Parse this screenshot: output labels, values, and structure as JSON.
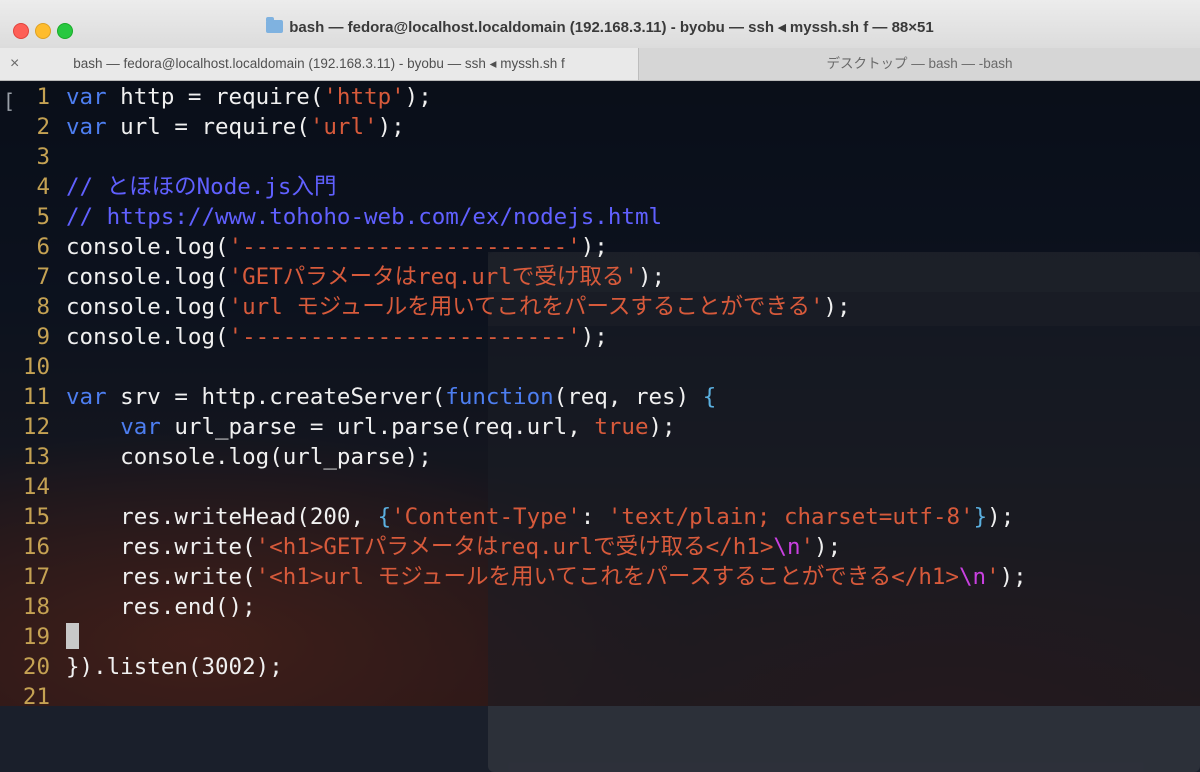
{
  "window": {
    "title": "bash — fedora@localhost.localdomain (192.168.3.11) - byobu — ssh ◂ myssh.sh f — 88×51"
  },
  "tabs": [
    {
      "label": "bash — fedora@localhost.localdomain (192.168.3.11) - byobu — ssh ◂ myssh.sh f",
      "active": true
    },
    {
      "label": "デスクトップ — bash — -bash",
      "active": false
    }
  ],
  "tab_close": "×",
  "bracket": "[",
  "colors": {
    "keyword": "#4d7ef0",
    "string": "#d75a3b",
    "comment": "#6060ff",
    "escape": "#c940e0",
    "line_number": "#c5a253"
  },
  "code": {
    "lines": [
      {
        "n": "1",
        "tokens": [
          [
            "kw",
            "var"
          ],
          [
            "p",
            " http = require("
          ],
          [
            "str",
            "'http'"
          ],
          [
            "p",
            ");"
          ]
        ]
      },
      {
        "n": "2",
        "tokens": [
          [
            "kw",
            "var"
          ],
          [
            "p",
            " url = require("
          ],
          [
            "str",
            "'url'"
          ],
          [
            "p",
            ");"
          ]
        ]
      },
      {
        "n": "3",
        "tokens": []
      },
      {
        "n": "4",
        "tokens": [
          [
            "cmt",
            "// とほほのNode.js入門"
          ]
        ]
      },
      {
        "n": "5",
        "tokens": [
          [
            "cmt",
            "// https://www.tohoho-web.com/ex/nodejs.html"
          ]
        ]
      },
      {
        "n": "6",
        "tokens": [
          [
            "p",
            "console.log("
          ],
          [
            "str",
            "'------------------------'"
          ],
          [
            "p",
            ");"
          ]
        ]
      },
      {
        "n": "7",
        "tokens": [
          [
            "p",
            "console.log("
          ],
          [
            "str",
            "'GETパラメータはreq.urlで受け取る'"
          ],
          [
            "p",
            ");"
          ]
        ]
      },
      {
        "n": "8",
        "tokens": [
          [
            "p",
            "console.log("
          ],
          [
            "str",
            "'url モジュールを用いてこれをパースすることができる'"
          ],
          [
            "p",
            ");"
          ]
        ]
      },
      {
        "n": "9",
        "tokens": [
          [
            "p",
            "console.log("
          ],
          [
            "str",
            "'------------------------'"
          ],
          [
            "p",
            ");"
          ]
        ]
      },
      {
        "n": "10",
        "tokens": []
      },
      {
        "n": "11",
        "tokens": [
          [
            "kw",
            "var"
          ],
          [
            "p",
            " srv = http.createServer("
          ],
          [
            "kw",
            "function"
          ],
          [
            "p",
            "(req, res) "
          ],
          [
            "brace",
            "{"
          ]
        ]
      },
      {
        "n": "12",
        "tokens": [
          [
            "p",
            "    "
          ],
          [
            "kw",
            "var"
          ],
          [
            "p",
            " url_parse = url.parse(req.url, "
          ],
          [
            "bool",
            "true"
          ],
          [
            "p",
            ");"
          ]
        ]
      },
      {
        "n": "13",
        "tokens": [
          [
            "p",
            "    console.log(url_parse);"
          ]
        ]
      },
      {
        "n": "14",
        "tokens": []
      },
      {
        "n": "15",
        "tokens": [
          [
            "p",
            "    res.writeHead(200, "
          ],
          [
            "brace",
            "{"
          ],
          [
            "str",
            "'Content-Type'"
          ],
          [
            "p",
            ": "
          ],
          [
            "str",
            "'text/plain; charset=utf-8'"
          ],
          [
            "brace",
            "}"
          ],
          [
            "p",
            ");"
          ]
        ]
      },
      {
        "n": "16",
        "tokens": [
          [
            "p",
            "    res.write("
          ],
          [
            "str",
            "'<h1>GETパラメータはreq.urlで受け取る</h1>"
          ],
          [
            "esc",
            "\\n"
          ],
          [
            "str",
            "'"
          ],
          [
            "p",
            ");"
          ]
        ]
      },
      {
        "n": "17",
        "tokens": [
          [
            "p",
            "    res.write("
          ],
          [
            "str",
            "'<h1>url モジュールを用いてこれをパースすることができる</h1>"
          ],
          [
            "esc",
            "\\n"
          ],
          [
            "str",
            "'"
          ],
          [
            "p",
            ");"
          ]
        ]
      },
      {
        "n": "18",
        "tokens": [
          [
            "p",
            "    res.end();"
          ]
        ]
      },
      {
        "n": "19",
        "tokens": [
          [
            "cursor",
            ""
          ]
        ]
      },
      {
        "n": "20",
        "tokens": [
          [
            "p",
            "}).listen(3002);"
          ]
        ]
      },
      {
        "n": "21",
        "tokens": []
      }
    ]
  }
}
